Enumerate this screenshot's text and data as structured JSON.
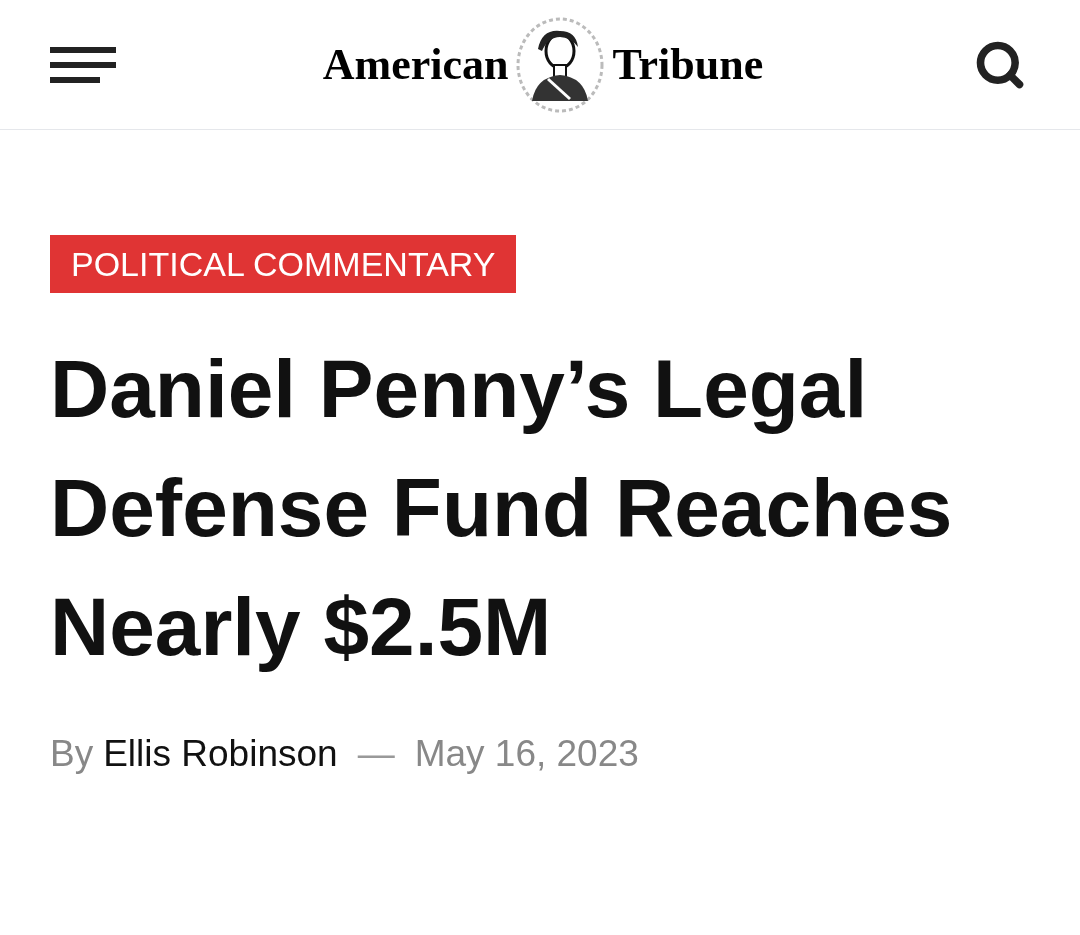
{
  "header": {
    "logo": {
      "left": "American",
      "right": "Tribune"
    }
  },
  "article": {
    "category": "POLITICAL COMMENTARY",
    "headline": "Daniel Penny’s Legal Defense Fund Reaches Nearly $2.5M",
    "byline": {
      "prefix": "By",
      "author": "Ellis Robinson",
      "separator": "—",
      "date": "May 16, 2023"
    }
  }
}
